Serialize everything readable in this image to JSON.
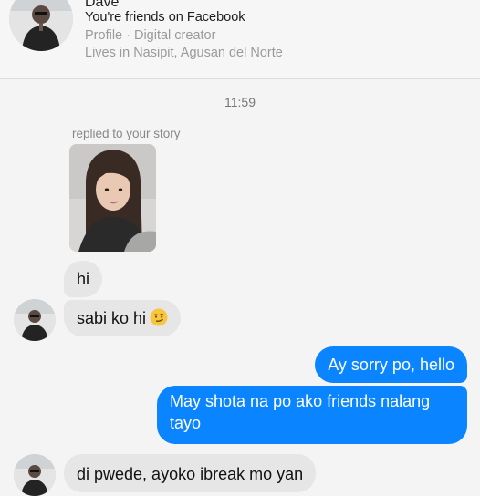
{
  "header": {
    "name": "Dave",
    "friends_text": "You're friends on Facebook",
    "profile_text": "Profile · Digital creator",
    "lives_text": "Lives in Nasipit, Agusan del Norte"
  },
  "thread": {
    "timestamp": "11:59",
    "replied_label": "replied to your story"
  },
  "messages": [
    {
      "from": "them",
      "text": "hi"
    },
    {
      "from": "them",
      "text": "sabi ko hi",
      "emoji": "smirking-face-icon"
    },
    {
      "from": "me",
      "text": "Ay sorry po, hello"
    },
    {
      "from": "me",
      "text": "May shota na po ako friends nalang tayo"
    },
    {
      "from": "them",
      "text": "di pwede, ayoko ibreak mo yan"
    }
  ],
  "colors": {
    "outgoing_bubble": "#0a84ff",
    "incoming_bubble": "#e6e6e6",
    "background": "#f4f4f4",
    "muted_text": "#9a9a9a"
  }
}
